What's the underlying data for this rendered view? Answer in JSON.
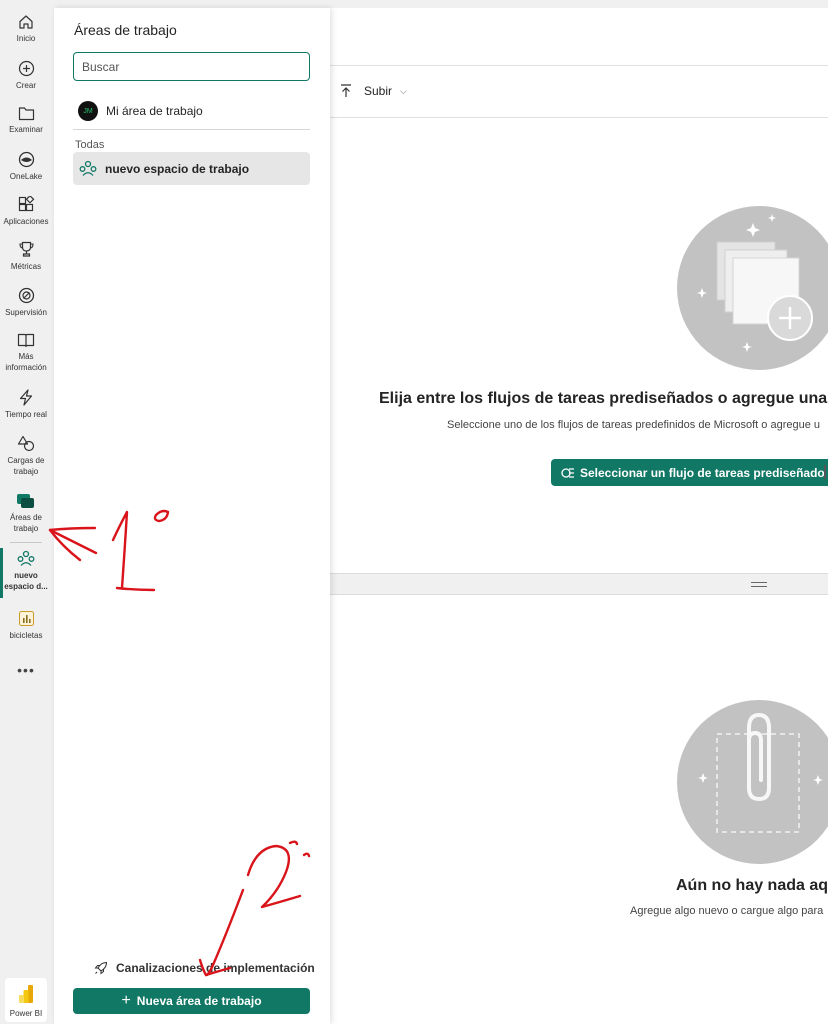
{
  "nav": {
    "items": [
      {
        "id": "inicio",
        "label": "Inicio",
        "icon": "home-icon"
      },
      {
        "id": "crear",
        "label": "Crear",
        "icon": "plus-circle-icon"
      },
      {
        "id": "examinar",
        "label": "Examinar",
        "icon": "folder-icon"
      },
      {
        "id": "onelake",
        "label": "OneLake",
        "icon": "onelake-icon"
      },
      {
        "id": "aplicaciones",
        "label": "Aplicaciones",
        "icon": "apps-icon"
      },
      {
        "id": "metricas",
        "label": "Métricas",
        "icon": "trophy-icon"
      },
      {
        "id": "supervision",
        "label": "Supervisión",
        "icon": "monitor-icon"
      },
      {
        "id": "mas_info",
        "label": "Más información",
        "icon": "book-icon"
      },
      {
        "id": "tiempo_real",
        "label": "Tiempo real",
        "icon": "lightning-icon"
      },
      {
        "id": "cargas",
        "label": "Cargas de trabajo",
        "icon": "shapes-icon"
      },
      {
        "id": "areas",
        "label": "Áreas de trabajo",
        "icon": "workspaces-icon"
      },
      {
        "id": "nuevo",
        "label": "nuevo espacio d...",
        "icon": "workspace-people-icon"
      },
      {
        "id": "bicicletas",
        "label": "bicicletas",
        "icon": "report-icon"
      }
    ],
    "more_label": "•••",
    "product": {
      "label": "Power BI",
      "icon": "power-bi-logo"
    }
  },
  "flyout": {
    "title": "Áreas de trabajo",
    "search_placeholder": "Buscar",
    "my_workspace": {
      "label": "Mi área de trabajo",
      "initials": "JM"
    },
    "section_label": "Todas",
    "workspaces": [
      {
        "label": "nuevo espacio de trabajo"
      }
    ],
    "pipelines_label": "Canalizaciones de implementación",
    "new_workspace_label": "Nueva área de trabajo"
  },
  "main": {
    "toolbar": {
      "upload_label": "Subir",
      "chevron": "⌵"
    },
    "task_flow": {
      "title": "Elija entre los flujos de tareas prediseñados o agregue una ta",
      "description": "Seleccione uno de los flujos de tareas predefinidos de Microsoft o agregue u",
      "button_label": "Seleccionar un flujo de tareas prediseñado"
    },
    "empty": {
      "title": "Aún no hay nada aqu",
      "description": "Agregue algo nuevo o cargue algo para"
    }
  },
  "annotations": {
    "mark_1": "1°",
    "mark_2": "2°"
  },
  "colors": {
    "accent": "#117865",
    "annotation": "#d9141b",
    "illustration": "#c2c2c2"
  }
}
